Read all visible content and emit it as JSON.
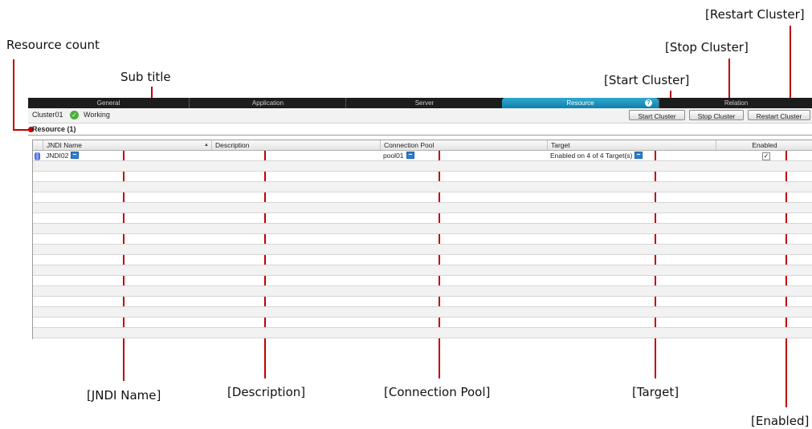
{
  "annotations": {
    "resource_count": "Resource count",
    "sub_title": "Sub title",
    "start_cluster": "[Start Cluster]",
    "stop_cluster": "[Stop Cluster]",
    "restart_cluster": "[Restart Cluster]",
    "jndi_name": "[JNDI Name]",
    "description": "[Description]",
    "connection_pool": "[Connection Pool]",
    "target": "[Target]",
    "enabled": "[Enabled]"
  },
  "tabs": [
    {
      "label": "General",
      "active": false
    },
    {
      "label": "Application",
      "active": false
    },
    {
      "label": "Server",
      "active": false
    },
    {
      "label": "Resource",
      "active": true
    },
    {
      "label": "Relation",
      "active": false
    }
  ],
  "help_badge": "?",
  "cluster": {
    "name": "Cluster01",
    "status_icon": "check-circle-icon",
    "status_color": "#4caf3e",
    "status": "Working"
  },
  "buttons": {
    "start": "Start Cluster",
    "stop": "Stop Cluster",
    "restart": "Restart Cluster"
  },
  "section_title": "Resource (1)",
  "table": {
    "columns": [
      "JNDI Name",
      "Description",
      "Connection Pool",
      "Target",
      "Enabled"
    ],
    "sort_indicator": "▲",
    "rows": [
      {
        "jndi_name": "JNDI02",
        "description": "",
        "connection_pool": "pool01",
        "target": "Enabled on 4 of 4 Target(s)",
        "enabled": true,
        "enabled_mark": "✓"
      }
    ]
  },
  "colors": {
    "accent_tab": "#1a93bd",
    "annotation_line": "#c00000"
  }
}
